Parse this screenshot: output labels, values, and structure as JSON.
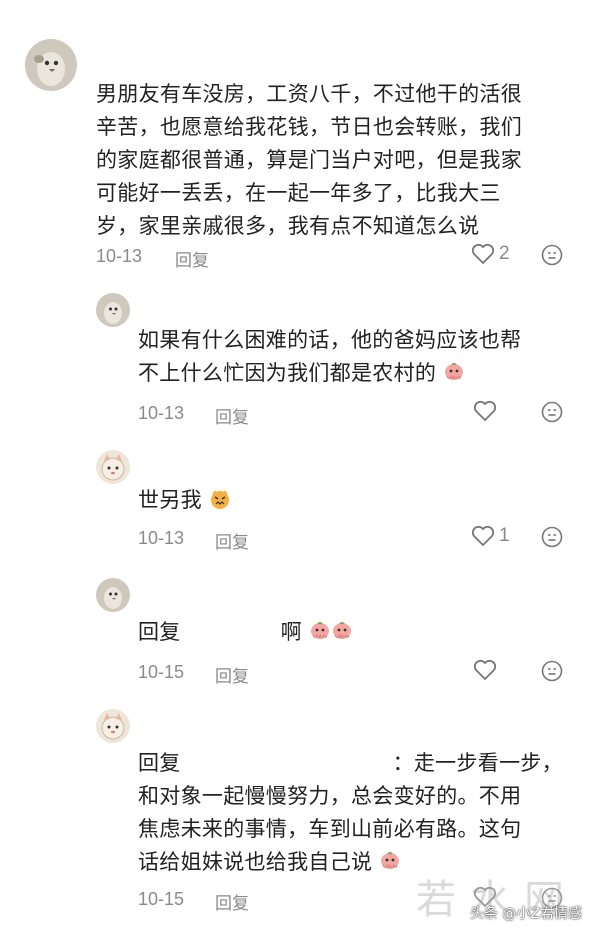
{
  "comments": [
    {
      "text": "男朋友有车没房，工资八千，不过他干的活很辛苦，也愿意给我花钱，节日也会转账，我们的家庭都很普通，算是门当户对吧，但是我家可能好一丢丢，在一起一年多了，比我大三岁，家里亲戚很多，我有点不知道怎么说",
      "lines": [
        "男朋友有车没房，工资八千，不过他干的活很",
        "辛苦，也愿意给我花钱，节日也会转账，我们",
        "的家庭都很普通，算是门当户对吧，但是我家",
        "可能好一丢丢，在一起一年多了，比我大三",
        "岁，家里亲戚很多，我有点不知道怎么说"
      ],
      "date": "10-13",
      "reply_label": "回复",
      "like_count": "2",
      "like_icon": "heart-icon",
      "more_icon": "emoji-reaction-icon"
    },
    {
      "lines": [
        "如果有什么困难的话，他的爸妈应该也帮",
        "不上什么忙因为我们都是农村的"
      ],
      "date": "10-13",
      "reply_label": "回复",
      "like_count": "",
      "emoji": "pink-octopus-emoji"
    },
    {
      "lines": [
        "世另我"
      ],
      "date": "10-13",
      "reply_label": "回复",
      "like_count": "1",
      "emoji": "angry-cat-emoji"
    },
    {
      "prefix": "回复",
      "suffix": "啊",
      "date": "10-15",
      "reply_label": "回复",
      "like_count": "",
      "emoji": "pink-octopus-emoji"
    },
    {
      "prefix": "回复",
      "colon_text": "：走一步看一步，",
      "lines": [
        "和对象一起慢慢努力，总会变好的。不用",
        "焦虑未来的事情，车到山前必有路。这句",
        "话给姐妹说也给我自己说"
      ],
      "date": "10-15",
      "reply_label": "回复",
      "like_count": "",
      "emoji": "pink-octopus-emoji"
    }
  ],
  "watermark": {
    "big": "若水网",
    "small": "头条 @小Z君情感"
  },
  "colors": {
    "text": "#222222",
    "meta": "#8a8a8a",
    "background": "#ffffff"
  }
}
